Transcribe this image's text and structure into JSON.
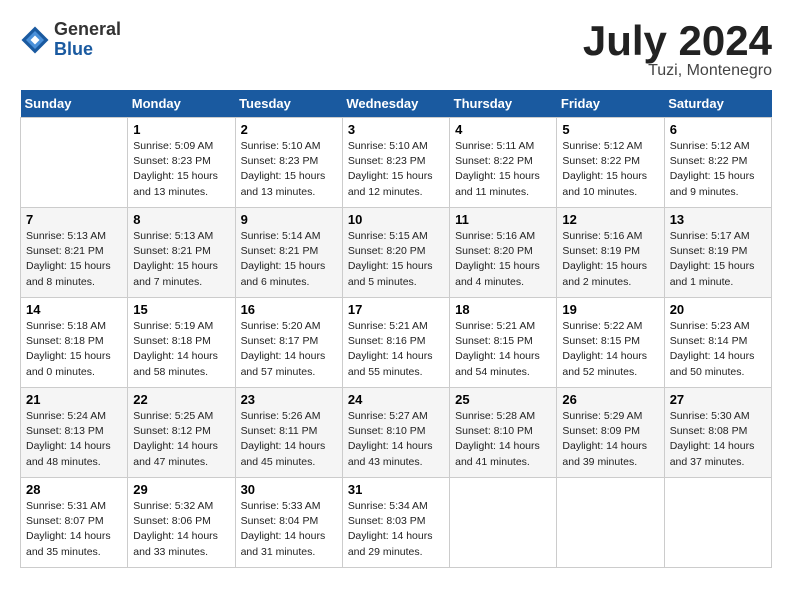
{
  "logo": {
    "general": "General",
    "blue": "Blue"
  },
  "title": "July 2024",
  "location": "Tuzi, Montenegro",
  "days_header": [
    "Sunday",
    "Monday",
    "Tuesday",
    "Wednesday",
    "Thursday",
    "Friday",
    "Saturday"
  ],
  "weeks": [
    [
      {
        "day": "",
        "info": ""
      },
      {
        "day": "1",
        "info": "Sunrise: 5:09 AM\nSunset: 8:23 PM\nDaylight: 15 hours\nand 13 minutes."
      },
      {
        "day": "2",
        "info": "Sunrise: 5:10 AM\nSunset: 8:23 PM\nDaylight: 15 hours\nand 13 minutes."
      },
      {
        "day": "3",
        "info": "Sunrise: 5:10 AM\nSunset: 8:23 PM\nDaylight: 15 hours\nand 12 minutes."
      },
      {
        "day": "4",
        "info": "Sunrise: 5:11 AM\nSunset: 8:22 PM\nDaylight: 15 hours\nand 11 minutes."
      },
      {
        "day": "5",
        "info": "Sunrise: 5:12 AM\nSunset: 8:22 PM\nDaylight: 15 hours\nand 10 minutes."
      },
      {
        "day": "6",
        "info": "Sunrise: 5:12 AM\nSunset: 8:22 PM\nDaylight: 15 hours\nand 9 minutes."
      }
    ],
    [
      {
        "day": "7",
        "info": "Sunrise: 5:13 AM\nSunset: 8:21 PM\nDaylight: 15 hours\nand 8 minutes."
      },
      {
        "day": "8",
        "info": "Sunrise: 5:13 AM\nSunset: 8:21 PM\nDaylight: 15 hours\nand 7 minutes."
      },
      {
        "day": "9",
        "info": "Sunrise: 5:14 AM\nSunset: 8:21 PM\nDaylight: 15 hours\nand 6 minutes."
      },
      {
        "day": "10",
        "info": "Sunrise: 5:15 AM\nSunset: 8:20 PM\nDaylight: 15 hours\nand 5 minutes."
      },
      {
        "day": "11",
        "info": "Sunrise: 5:16 AM\nSunset: 8:20 PM\nDaylight: 15 hours\nand 4 minutes."
      },
      {
        "day": "12",
        "info": "Sunrise: 5:16 AM\nSunset: 8:19 PM\nDaylight: 15 hours\nand 2 minutes."
      },
      {
        "day": "13",
        "info": "Sunrise: 5:17 AM\nSunset: 8:19 PM\nDaylight: 15 hours\nand 1 minute."
      }
    ],
    [
      {
        "day": "14",
        "info": "Sunrise: 5:18 AM\nSunset: 8:18 PM\nDaylight: 15 hours\nand 0 minutes."
      },
      {
        "day": "15",
        "info": "Sunrise: 5:19 AM\nSunset: 8:18 PM\nDaylight: 14 hours\nand 58 minutes."
      },
      {
        "day": "16",
        "info": "Sunrise: 5:20 AM\nSunset: 8:17 PM\nDaylight: 14 hours\nand 57 minutes."
      },
      {
        "day": "17",
        "info": "Sunrise: 5:21 AM\nSunset: 8:16 PM\nDaylight: 14 hours\nand 55 minutes."
      },
      {
        "day": "18",
        "info": "Sunrise: 5:21 AM\nSunset: 8:15 PM\nDaylight: 14 hours\nand 54 minutes."
      },
      {
        "day": "19",
        "info": "Sunrise: 5:22 AM\nSunset: 8:15 PM\nDaylight: 14 hours\nand 52 minutes."
      },
      {
        "day": "20",
        "info": "Sunrise: 5:23 AM\nSunset: 8:14 PM\nDaylight: 14 hours\nand 50 minutes."
      }
    ],
    [
      {
        "day": "21",
        "info": "Sunrise: 5:24 AM\nSunset: 8:13 PM\nDaylight: 14 hours\nand 48 minutes."
      },
      {
        "day": "22",
        "info": "Sunrise: 5:25 AM\nSunset: 8:12 PM\nDaylight: 14 hours\nand 47 minutes."
      },
      {
        "day": "23",
        "info": "Sunrise: 5:26 AM\nSunset: 8:11 PM\nDaylight: 14 hours\nand 45 minutes."
      },
      {
        "day": "24",
        "info": "Sunrise: 5:27 AM\nSunset: 8:10 PM\nDaylight: 14 hours\nand 43 minutes."
      },
      {
        "day": "25",
        "info": "Sunrise: 5:28 AM\nSunset: 8:10 PM\nDaylight: 14 hours\nand 41 minutes."
      },
      {
        "day": "26",
        "info": "Sunrise: 5:29 AM\nSunset: 8:09 PM\nDaylight: 14 hours\nand 39 minutes."
      },
      {
        "day": "27",
        "info": "Sunrise: 5:30 AM\nSunset: 8:08 PM\nDaylight: 14 hours\nand 37 minutes."
      }
    ],
    [
      {
        "day": "28",
        "info": "Sunrise: 5:31 AM\nSunset: 8:07 PM\nDaylight: 14 hours\nand 35 minutes."
      },
      {
        "day": "29",
        "info": "Sunrise: 5:32 AM\nSunset: 8:06 PM\nDaylight: 14 hours\nand 33 minutes."
      },
      {
        "day": "30",
        "info": "Sunrise: 5:33 AM\nSunset: 8:04 PM\nDaylight: 14 hours\nand 31 minutes."
      },
      {
        "day": "31",
        "info": "Sunrise: 5:34 AM\nSunset: 8:03 PM\nDaylight: 14 hours\nand 29 minutes."
      },
      {
        "day": "",
        "info": ""
      },
      {
        "day": "",
        "info": ""
      },
      {
        "day": "",
        "info": ""
      }
    ]
  ]
}
